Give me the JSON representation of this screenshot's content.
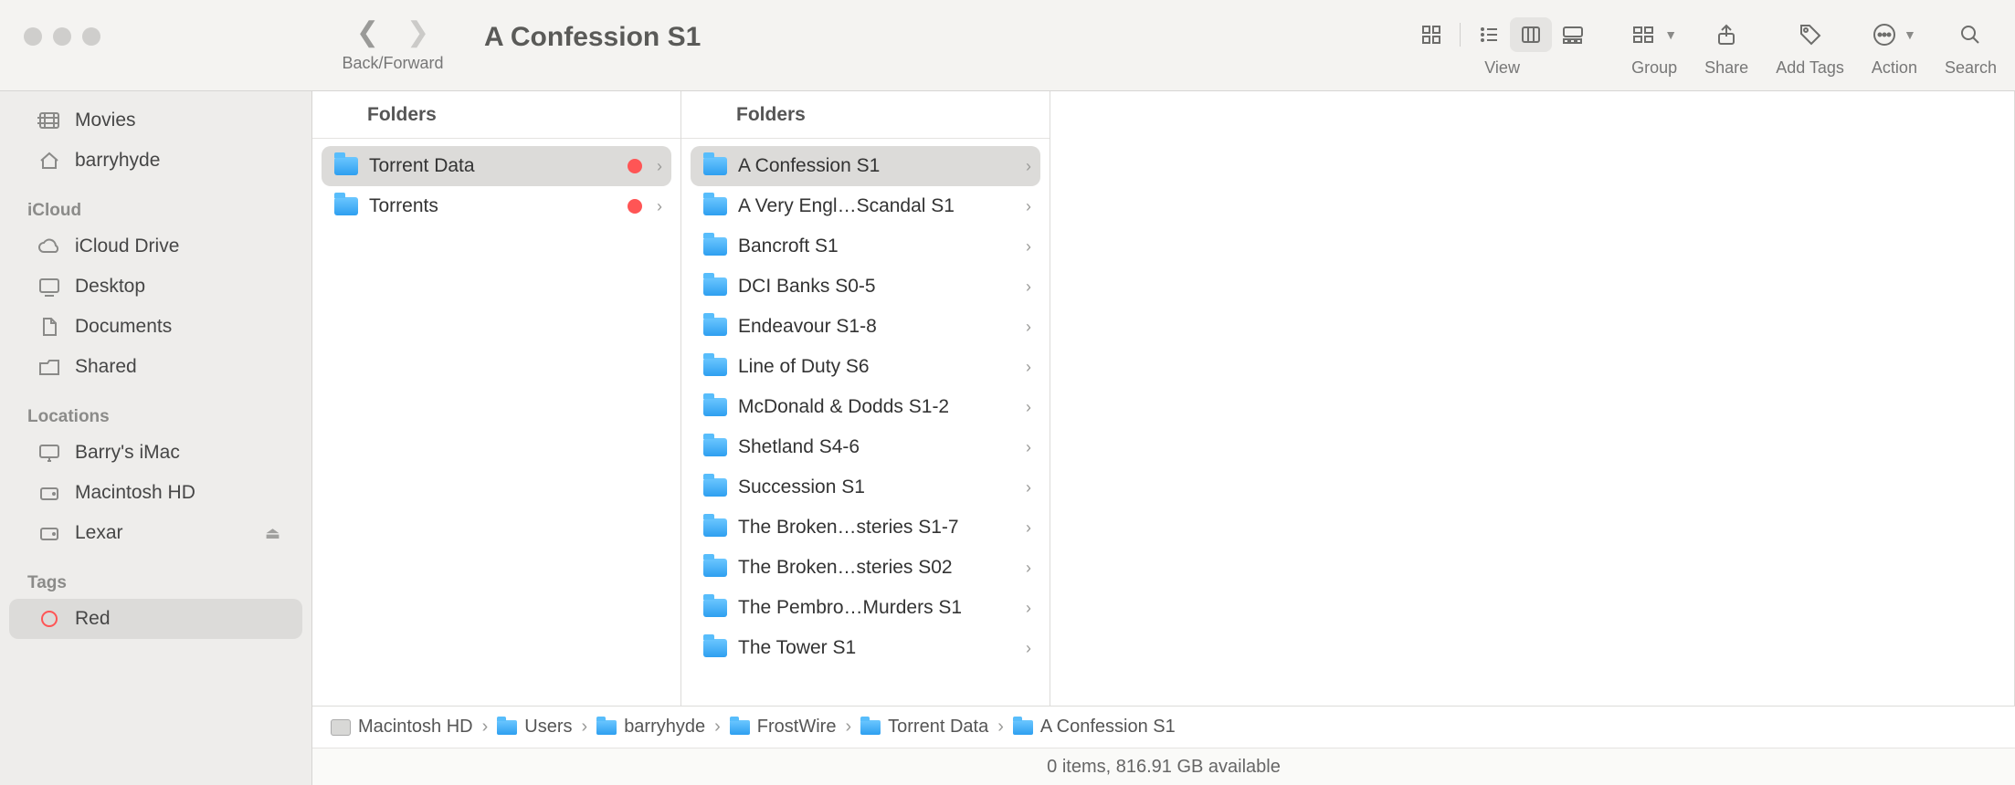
{
  "window": {
    "title": "A Confession S1",
    "nav_label": "Back/Forward",
    "view_label": "View",
    "group_label": "Group",
    "share_label": "Share",
    "addtags_label": "Add Tags",
    "action_label": "Action",
    "search_label": "Search"
  },
  "sidebar": {
    "favorites": [
      {
        "name": "Movies",
        "icon": "film"
      },
      {
        "name": "barryhyde",
        "icon": "home"
      }
    ],
    "icloud_head": "iCloud",
    "icloud": [
      {
        "name": "iCloud Drive",
        "icon": "cloud"
      },
      {
        "name": "Desktop",
        "icon": "desktop"
      },
      {
        "name": "Documents",
        "icon": "doc"
      },
      {
        "name": "Shared",
        "icon": "shared"
      }
    ],
    "locations_head": "Locations",
    "locations": [
      {
        "name": "Barry's iMac",
        "icon": "imac"
      },
      {
        "name": "Macintosh HD",
        "icon": "disk"
      },
      {
        "name": "Lexar",
        "icon": "disk",
        "eject": true
      }
    ],
    "tags_head": "Tags",
    "tags": [
      {
        "name": "Red",
        "selected": true
      }
    ]
  },
  "columns": {
    "head1": "Folders",
    "head2": "Folders",
    "col1": [
      {
        "name": "Torrent Data",
        "tag": "red",
        "selected": true,
        "children": true
      },
      {
        "name": "Torrents",
        "tag": "red",
        "children": true
      }
    ],
    "col2": [
      {
        "name": "A Confession S1",
        "selected": true,
        "children": true
      },
      {
        "name": "A Very Engl…Scandal S1",
        "children": true
      },
      {
        "name": "Bancroft S1",
        "children": true
      },
      {
        "name": "DCI Banks S0-5",
        "children": true
      },
      {
        "name": "Endeavour S1-8",
        "children": true
      },
      {
        "name": "Line of Duty S6",
        "children": true
      },
      {
        "name": "McDonald & Dodds S1-2",
        "children": true
      },
      {
        "name": "Shetland S4-6",
        "children": true
      },
      {
        "name": "Succession S1",
        "children": true
      },
      {
        "name": "The Broken…steries S1-7",
        "children": true
      },
      {
        "name": "The Broken…steries S02",
        "children": true
      },
      {
        "name": "The Pembro…Murders S1",
        "children": true
      },
      {
        "name": "The Tower S1",
        "children": true
      }
    ]
  },
  "pathbar": [
    {
      "name": "Macintosh HD",
      "icon": "disk"
    },
    {
      "name": "Users",
      "icon": "folder"
    },
    {
      "name": "barryhyde",
      "icon": "folder"
    },
    {
      "name": "FrostWire",
      "icon": "folder"
    },
    {
      "name": "Torrent Data",
      "icon": "folder"
    },
    {
      "name": "A Confession S1",
      "icon": "folder"
    }
  ],
  "status": "0 items, 816.91 GB available"
}
